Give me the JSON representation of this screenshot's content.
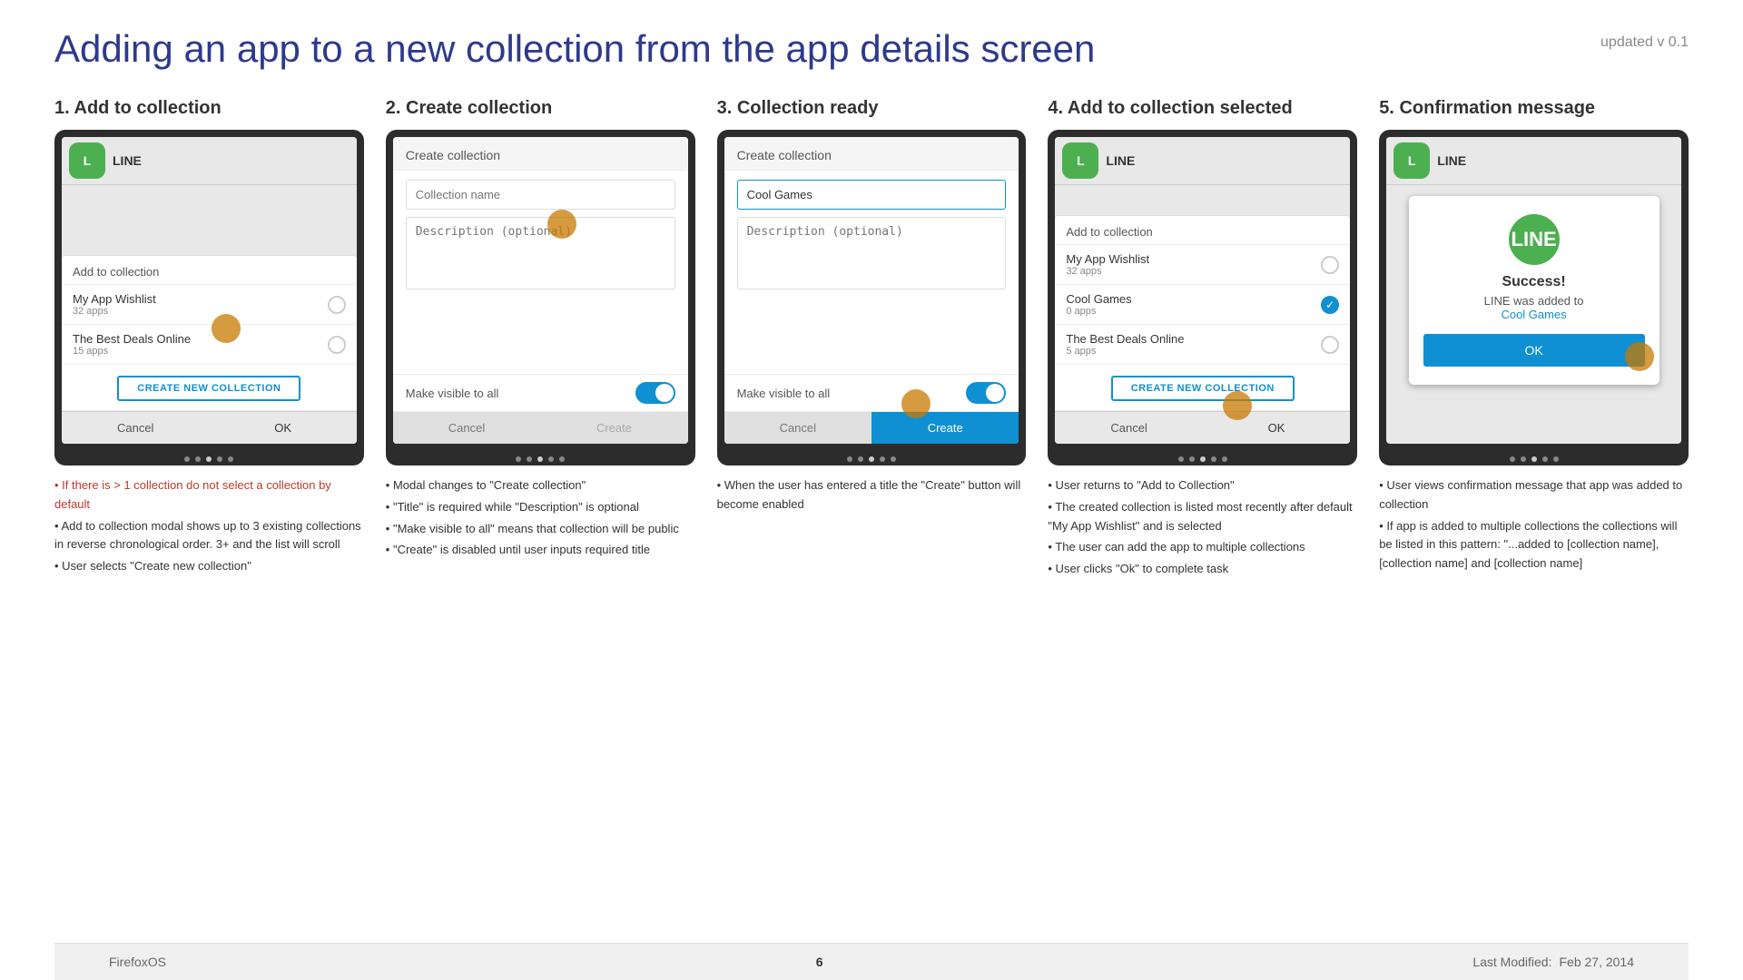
{
  "header": {
    "title": "Adding an app to a new collection from the app details screen",
    "version": "updated v 0.1"
  },
  "steps": [
    {
      "number": "1.",
      "title": "Add to collection",
      "modal_title": "Add to collection",
      "collections": [
        {
          "name": "My App Wishlist",
          "count": "32 apps"
        },
        {
          "name": "The Best Deals Online",
          "count": "15 apps"
        }
      ],
      "create_btn": "CREATE NEW COLLECTION",
      "cancel": "Cancel",
      "ok": "OK",
      "description": [
        "• If there is > 1 collection do not select a collection by default",
        "• Add to collection modal shows up to 3 existing collections in reverse chronological order. 3+ and the list will scroll",
        "• User selects \"Create new collection\""
      ]
    },
    {
      "number": "2.",
      "title": "Create collection",
      "modal_title": "Create collection",
      "name_placeholder": "Collection name",
      "desc_placeholder": "Description (optional)",
      "toggle_label": "Make visible to all",
      "cancel": "Cancel",
      "create": "Create",
      "description": [
        "• Modal changes to \"Create collection\"",
        "• \"Title\" is required while \"Description\" is optional",
        "• \"Make visible to all\" means that collection will be public",
        "• \"Create\" is disabled until user inputs required title"
      ]
    },
    {
      "number": "3.",
      "title": "Collection ready",
      "modal_title": "Create collection",
      "name_value": "Cool Games",
      "desc_placeholder": "Description (optional)",
      "toggle_label": "Make visible to all",
      "cancel": "Cancel",
      "create": "Create",
      "description": [
        "• When the user has entered a title the \"Create\" button will become enabled"
      ]
    },
    {
      "number": "4.",
      "title": "Add to collection selected",
      "modal_title": "Add to collection",
      "collections": [
        {
          "name": "My App Wishlist",
          "count": "32 apps",
          "checked": false
        },
        {
          "name": "Cool Games",
          "count": "0 apps",
          "checked": true
        },
        {
          "name": "The Best Deals Online",
          "count": "5 apps",
          "checked": false
        }
      ],
      "create_btn": "CREATE NEW COLLECTION",
      "cancel": "Cancel",
      "ok": "OK",
      "description": [
        "• User returns to \"Add to Collection\"",
        "• The created collection is listed most recently after default \"My App Wishlist\" and is selected",
        "•  The user can add the app to multiple collections",
        "• User clicks \"Ok\" to complete task"
      ]
    },
    {
      "number": "5.",
      "title": "Confirmation message",
      "success_title": "Success!",
      "success_line1": "LINE was added to",
      "success_link": "Cool Games",
      "ok": "OK",
      "description": [
        "• User views confirmation message that app was added to collection",
        "• If app is added to multiple collections the collections will be listed in this pattern:  \"...added to [collection name], [collection name] and [collection name]"
      ]
    }
  ],
  "footer": {
    "brand": "FirefoxOS",
    "page_num": "6",
    "last_modified_label": "Last Modified:",
    "last_modified_date": "Feb 27, 2014"
  }
}
